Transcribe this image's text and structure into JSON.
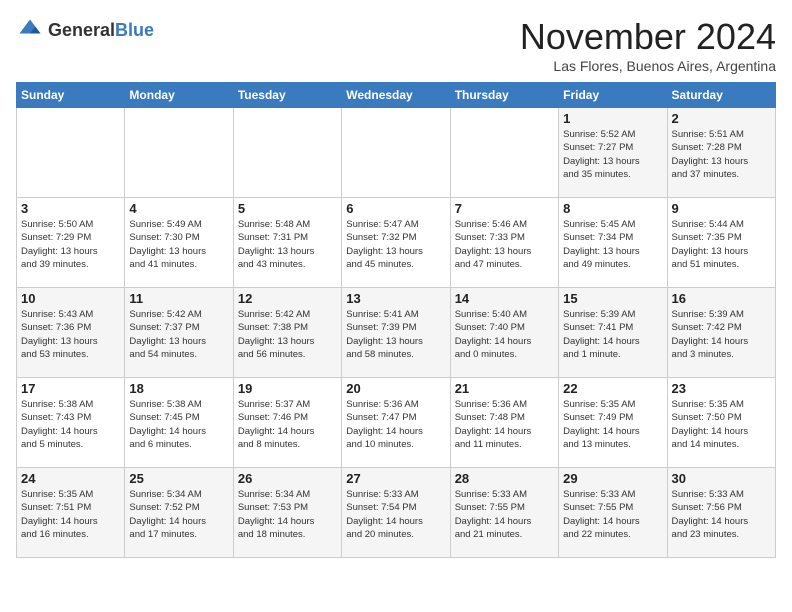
{
  "header": {
    "logo_general": "General",
    "logo_blue": "Blue",
    "month_title": "November 2024",
    "location": "Las Flores, Buenos Aires, Argentina"
  },
  "days_of_week": [
    "Sunday",
    "Monday",
    "Tuesday",
    "Wednesday",
    "Thursday",
    "Friday",
    "Saturday"
  ],
  "weeks": [
    [
      {
        "day": "",
        "info": ""
      },
      {
        "day": "",
        "info": ""
      },
      {
        "day": "",
        "info": ""
      },
      {
        "day": "",
        "info": ""
      },
      {
        "day": "",
        "info": ""
      },
      {
        "day": "1",
        "info": "Sunrise: 5:52 AM\nSunset: 7:27 PM\nDaylight: 13 hours\nand 35 minutes."
      },
      {
        "day": "2",
        "info": "Sunrise: 5:51 AM\nSunset: 7:28 PM\nDaylight: 13 hours\nand 37 minutes."
      }
    ],
    [
      {
        "day": "3",
        "info": "Sunrise: 5:50 AM\nSunset: 7:29 PM\nDaylight: 13 hours\nand 39 minutes."
      },
      {
        "day": "4",
        "info": "Sunrise: 5:49 AM\nSunset: 7:30 PM\nDaylight: 13 hours\nand 41 minutes."
      },
      {
        "day": "5",
        "info": "Sunrise: 5:48 AM\nSunset: 7:31 PM\nDaylight: 13 hours\nand 43 minutes."
      },
      {
        "day": "6",
        "info": "Sunrise: 5:47 AM\nSunset: 7:32 PM\nDaylight: 13 hours\nand 45 minutes."
      },
      {
        "day": "7",
        "info": "Sunrise: 5:46 AM\nSunset: 7:33 PM\nDaylight: 13 hours\nand 47 minutes."
      },
      {
        "day": "8",
        "info": "Sunrise: 5:45 AM\nSunset: 7:34 PM\nDaylight: 13 hours\nand 49 minutes."
      },
      {
        "day": "9",
        "info": "Sunrise: 5:44 AM\nSunset: 7:35 PM\nDaylight: 13 hours\nand 51 minutes."
      }
    ],
    [
      {
        "day": "10",
        "info": "Sunrise: 5:43 AM\nSunset: 7:36 PM\nDaylight: 13 hours\nand 53 minutes."
      },
      {
        "day": "11",
        "info": "Sunrise: 5:42 AM\nSunset: 7:37 PM\nDaylight: 13 hours\nand 54 minutes."
      },
      {
        "day": "12",
        "info": "Sunrise: 5:42 AM\nSunset: 7:38 PM\nDaylight: 13 hours\nand 56 minutes."
      },
      {
        "day": "13",
        "info": "Sunrise: 5:41 AM\nSunset: 7:39 PM\nDaylight: 13 hours\nand 58 minutes."
      },
      {
        "day": "14",
        "info": "Sunrise: 5:40 AM\nSunset: 7:40 PM\nDaylight: 14 hours\nand 0 minutes."
      },
      {
        "day": "15",
        "info": "Sunrise: 5:39 AM\nSunset: 7:41 PM\nDaylight: 14 hours\nand 1 minute."
      },
      {
        "day": "16",
        "info": "Sunrise: 5:39 AM\nSunset: 7:42 PM\nDaylight: 14 hours\nand 3 minutes."
      }
    ],
    [
      {
        "day": "17",
        "info": "Sunrise: 5:38 AM\nSunset: 7:43 PM\nDaylight: 14 hours\nand 5 minutes."
      },
      {
        "day": "18",
        "info": "Sunrise: 5:38 AM\nSunset: 7:45 PM\nDaylight: 14 hours\nand 6 minutes."
      },
      {
        "day": "19",
        "info": "Sunrise: 5:37 AM\nSunset: 7:46 PM\nDaylight: 14 hours\nand 8 minutes."
      },
      {
        "day": "20",
        "info": "Sunrise: 5:36 AM\nSunset: 7:47 PM\nDaylight: 14 hours\nand 10 minutes."
      },
      {
        "day": "21",
        "info": "Sunrise: 5:36 AM\nSunset: 7:48 PM\nDaylight: 14 hours\nand 11 minutes."
      },
      {
        "day": "22",
        "info": "Sunrise: 5:35 AM\nSunset: 7:49 PM\nDaylight: 14 hours\nand 13 minutes."
      },
      {
        "day": "23",
        "info": "Sunrise: 5:35 AM\nSunset: 7:50 PM\nDaylight: 14 hours\nand 14 minutes."
      }
    ],
    [
      {
        "day": "24",
        "info": "Sunrise: 5:35 AM\nSunset: 7:51 PM\nDaylight: 14 hours\nand 16 minutes."
      },
      {
        "day": "25",
        "info": "Sunrise: 5:34 AM\nSunset: 7:52 PM\nDaylight: 14 hours\nand 17 minutes."
      },
      {
        "day": "26",
        "info": "Sunrise: 5:34 AM\nSunset: 7:53 PM\nDaylight: 14 hours\nand 18 minutes."
      },
      {
        "day": "27",
        "info": "Sunrise: 5:33 AM\nSunset: 7:54 PM\nDaylight: 14 hours\nand 20 minutes."
      },
      {
        "day": "28",
        "info": "Sunrise: 5:33 AM\nSunset: 7:55 PM\nDaylight: 14 hours\nand 21 minutes."
      },
      {
        "day": "29",
        "info": "Sunrise: 5:33 AM\nSunset: 7:55 PM\nDaylight: 14 hours\nand 22 minutes."
      },
      {
        "day": "30",
        "info": "Sunrise: 5:33 AM\nSunset: 7:56 PM\nDaylight: 14 hours\nand 23 minutes."
      }
    ]
  ]
}
